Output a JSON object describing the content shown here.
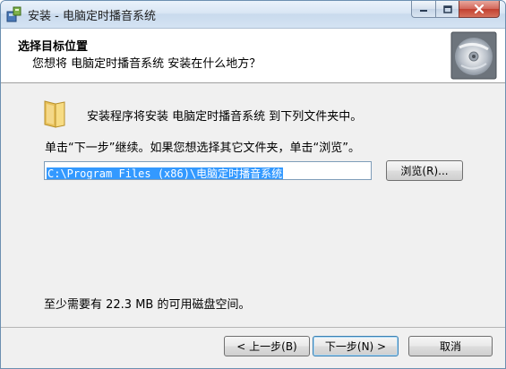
{
  "window": {
    "title": "安装 - 电脑定时播音系统",
    "app_icon": "installer-icon",
    "caption": {
      "minimize_icon": "minimize-icon",
      "maximize_icon": "maximize-icon",
      "close_icon": "close-icon"
    }
  },
  "header": {
    "title": "选择目标位置",
    "subtitle": "您想将 电脑定时播音系统 安装在什么地方？",
    "image_icon": "cd-disc-icon"
  },
  "main": {
    "folder_icon": "folder-icon",
    "intro": "安装程序将安装 电脑定时播音系统 到下列文件夹中。",
    "instruction": "单击“下一步”继续。如果您想选择其它文件夹，单击“浏览”。",
    "path_value": "C:\\Program Files (x86)\\电脑定时播音系统",
    "browse_label": "浏览(R)...",
    "disk_space": "至少需要有 22.3 MB 的可用磁盘空间。"
  },
  "footer": {
    "back_label": "< 上一步(B)",
    "next_label": "下一步(N) >",
    "cancel_label": "取消"
  },
  "colors": {
    "selection": "#3399ff",
    "close_button": "#c2402f",
    "dialog_bg": "#f0f0f0"
  }
}
